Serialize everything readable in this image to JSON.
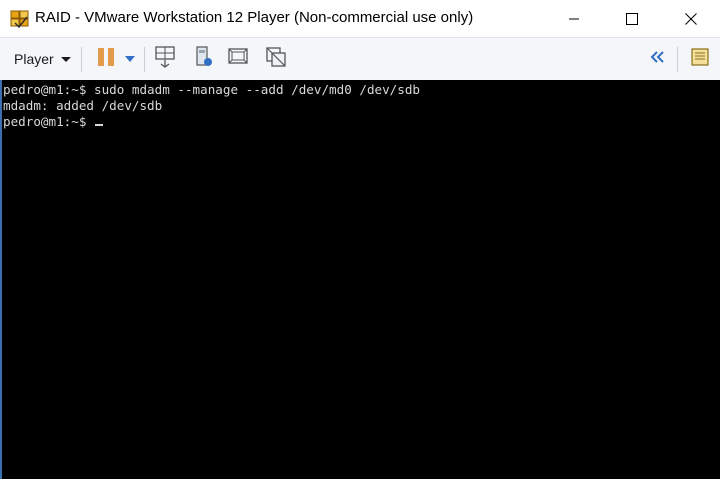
{
  "window": {
    "title": "RAID - VMware Workstation 12 Player (Non-commercial use only)",
    "app_icon": "vmware-player-icon",
    "controls": [
      "minimize-icon",
      "maximize-icon",
      "close-icon"
    ]
  },
  "toolbar": {
    "player_menu_label": "Player",
    "icons": [
      "pause-icon",
      "pause-dropdown-icon",
      "send-ctrl-alt-del-icon",
      "removable-devices-icon",
      "full-screen-icon",
      "unity-icon"
    ],
    "right_icons": [
      "collapse-toolbar-icon",
      "library-icon"
    ],
    "accent_color": "#2f6fc6"
  },
  "terminal": {
    "lines": [
      "pedro@m1:~$ sudo mdadm --manage --add /dev/md0 /dev/sdb",
      "mdadm: added /dev/sdb",
      "pedro@m1:~$ "
    ]
  }
}
